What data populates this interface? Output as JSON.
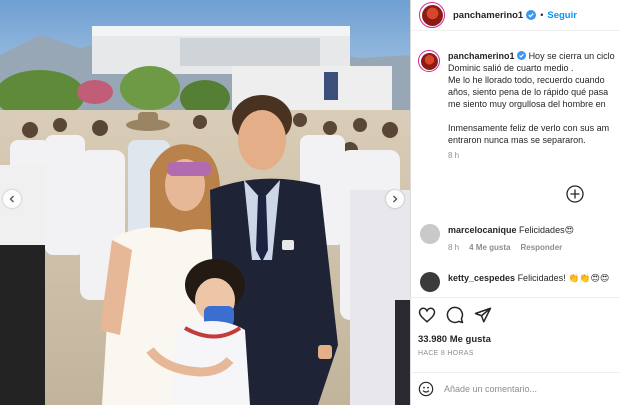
{
  "post": {
    "username": "panchamerino1",
    "follow_label": "Seguir",
    "header_separator": "•",
    "caption_lines": [
      "Hoy se cierra un ciclo",
      "Dominic salió de cuarto medio .",
      "Me lo he llorado todo, recuerdo cuando",
      "años, siento pena de lo rápido qué pasa",
      "me siento muy orgullosa del hombre en"
    ],
    "caption_lines_2": [
      "Inmensamente feliz de verlo con sus am",
      "entraron nunca mas se separaron."
    ],
    "caption_time": "8 h"
  },
  "comments": [
    {
      "username": "marcelocanique",
      "text": "Felicidades😍",
      "time": "8 h",
      "likes": "4 Me gusta",
      "reply": "Responder"
    },
    {
      "username": "ketty_cespedes",
      "text": "Felicidades! 👏👏😍😍"
    }
  ],
  "stats": {
    "likes": "33.980 Me gusta",
    "posted": "HACE 8 HORAS"
  },
  "composer": {
    "placeholder": "Añade un comentario..."
  },
  "colors": {
    "accent": "#0095f6",
    "muted": "#8e8e8e",
    "text": "#262626"
  }
}
